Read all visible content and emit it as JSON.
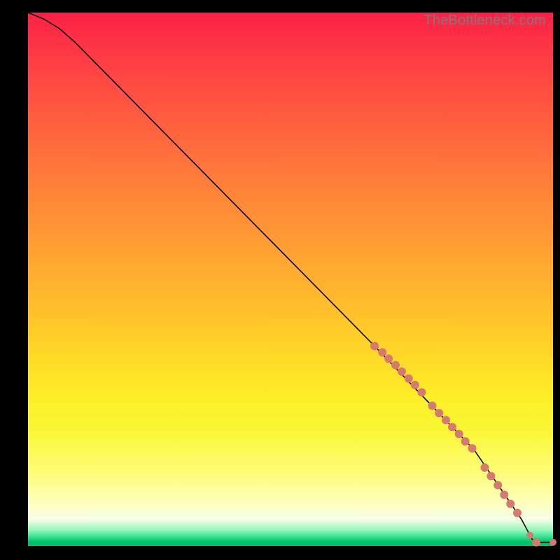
{
  "watermark": "TheBottleneck.com",
  "colors": {
    "point_fill": "#d67a6f",
    "curve_stroke": "#000000"
  },
  "chart_data": {
    "type": "line",
    "xlim": [
      0,
      100
    ],
    "ylim": [
      0,
      100
    ],
    "curve": [
      {
        "x": 0,
        "y": 100
      },
      {
        "x": 3,
        "y": 98.8
      },
      {
        "x": 6,
        "y": 97.0
      },
      {
        "x": 9,
        "y": 94.4
      },
      {
        "x": 12,
        "y": 91.4
      },
      {
        "x": 66,
        "y": 37.5
      },
      {
        "x": 85,
        "y": 18.0
      },
      {
        "x": 94,
        "y": 5.0
      },
      {
        "x": 96,
        "y": 1.3
      },
      {
        "x": 97,
        "y": 0.7
      },
      {
        "x": 100,
        "y": 0.7
      }
    ],
    "points": [
      {
        "x": 66.0,
        "y": 37.5,
        "r": 6
      },
      {
        "x": 67.5,
        "y": 36.3,
        "r": 6
      },
      {
        "x": 68.7,
        "y": 35.1,
        "r": 6
      },
      {
        "x": 70.0,
        "y": 33.9,
        "r": 6
      },
      {
        "x": 71.2,
        "y": 32.7,
        "r": 6
      },
      {
        "x": 72.5,
        "y": 31.4,
        "r": 6
      },
      {
        "x": 73.7,
        "y": 30.2,
        "r": 6
      },
      {
        "x": 75.0,
        "y": 28.8,
        "r": 6
      },
      {
        "x": 77.0,
        "y": 26.3,
        "r": 6
      },
      {
        "x": 78.3,
        "y": 24.9,
        "r": 6
      },
      {
        "x": 79.6,
        "y": 23.6,
        "r": 6
      },
      {
        "x": 80.8,
        "y": 22.3,
        "r": 6
      },
      {
        "x": 82.1,
        "y": 21.0,
        "r": 6
      },
      {
        "x": 83.3,
        "y": 19.6,
        "r": 6
      },
      {
        "x": 84.6,
        "y": 18.3,
        "r": 6
      },
      {
        "x": 87.0,
        "y": 14.7,
        "r": 6
      },
      {
        "x": 88.2,
        "y": 13.1,
        "r": 6
      },
      {
        "x": 89.5,
        "y": 11.4,
        "r": 6
      },
      {
        "x": 90.7,
        "y": 9.6,
        "r": 6
      },
      {
        "x": 91.9,
        "y": 7.9,
        "r": 6
      },
      {
        "x": 93.2,
        "y": 6.2,
        "r": 6
      },
      {
        "x": 95.6,
        "y": 2.0,
        "r": 5
      },
      {
        "x": 96.8,
        "y": 0.7,
        "r": 6
      },
      {
        "x": 100.0,
        "y": 0.7,
        "r": 5
      }
    ]
  }
}
